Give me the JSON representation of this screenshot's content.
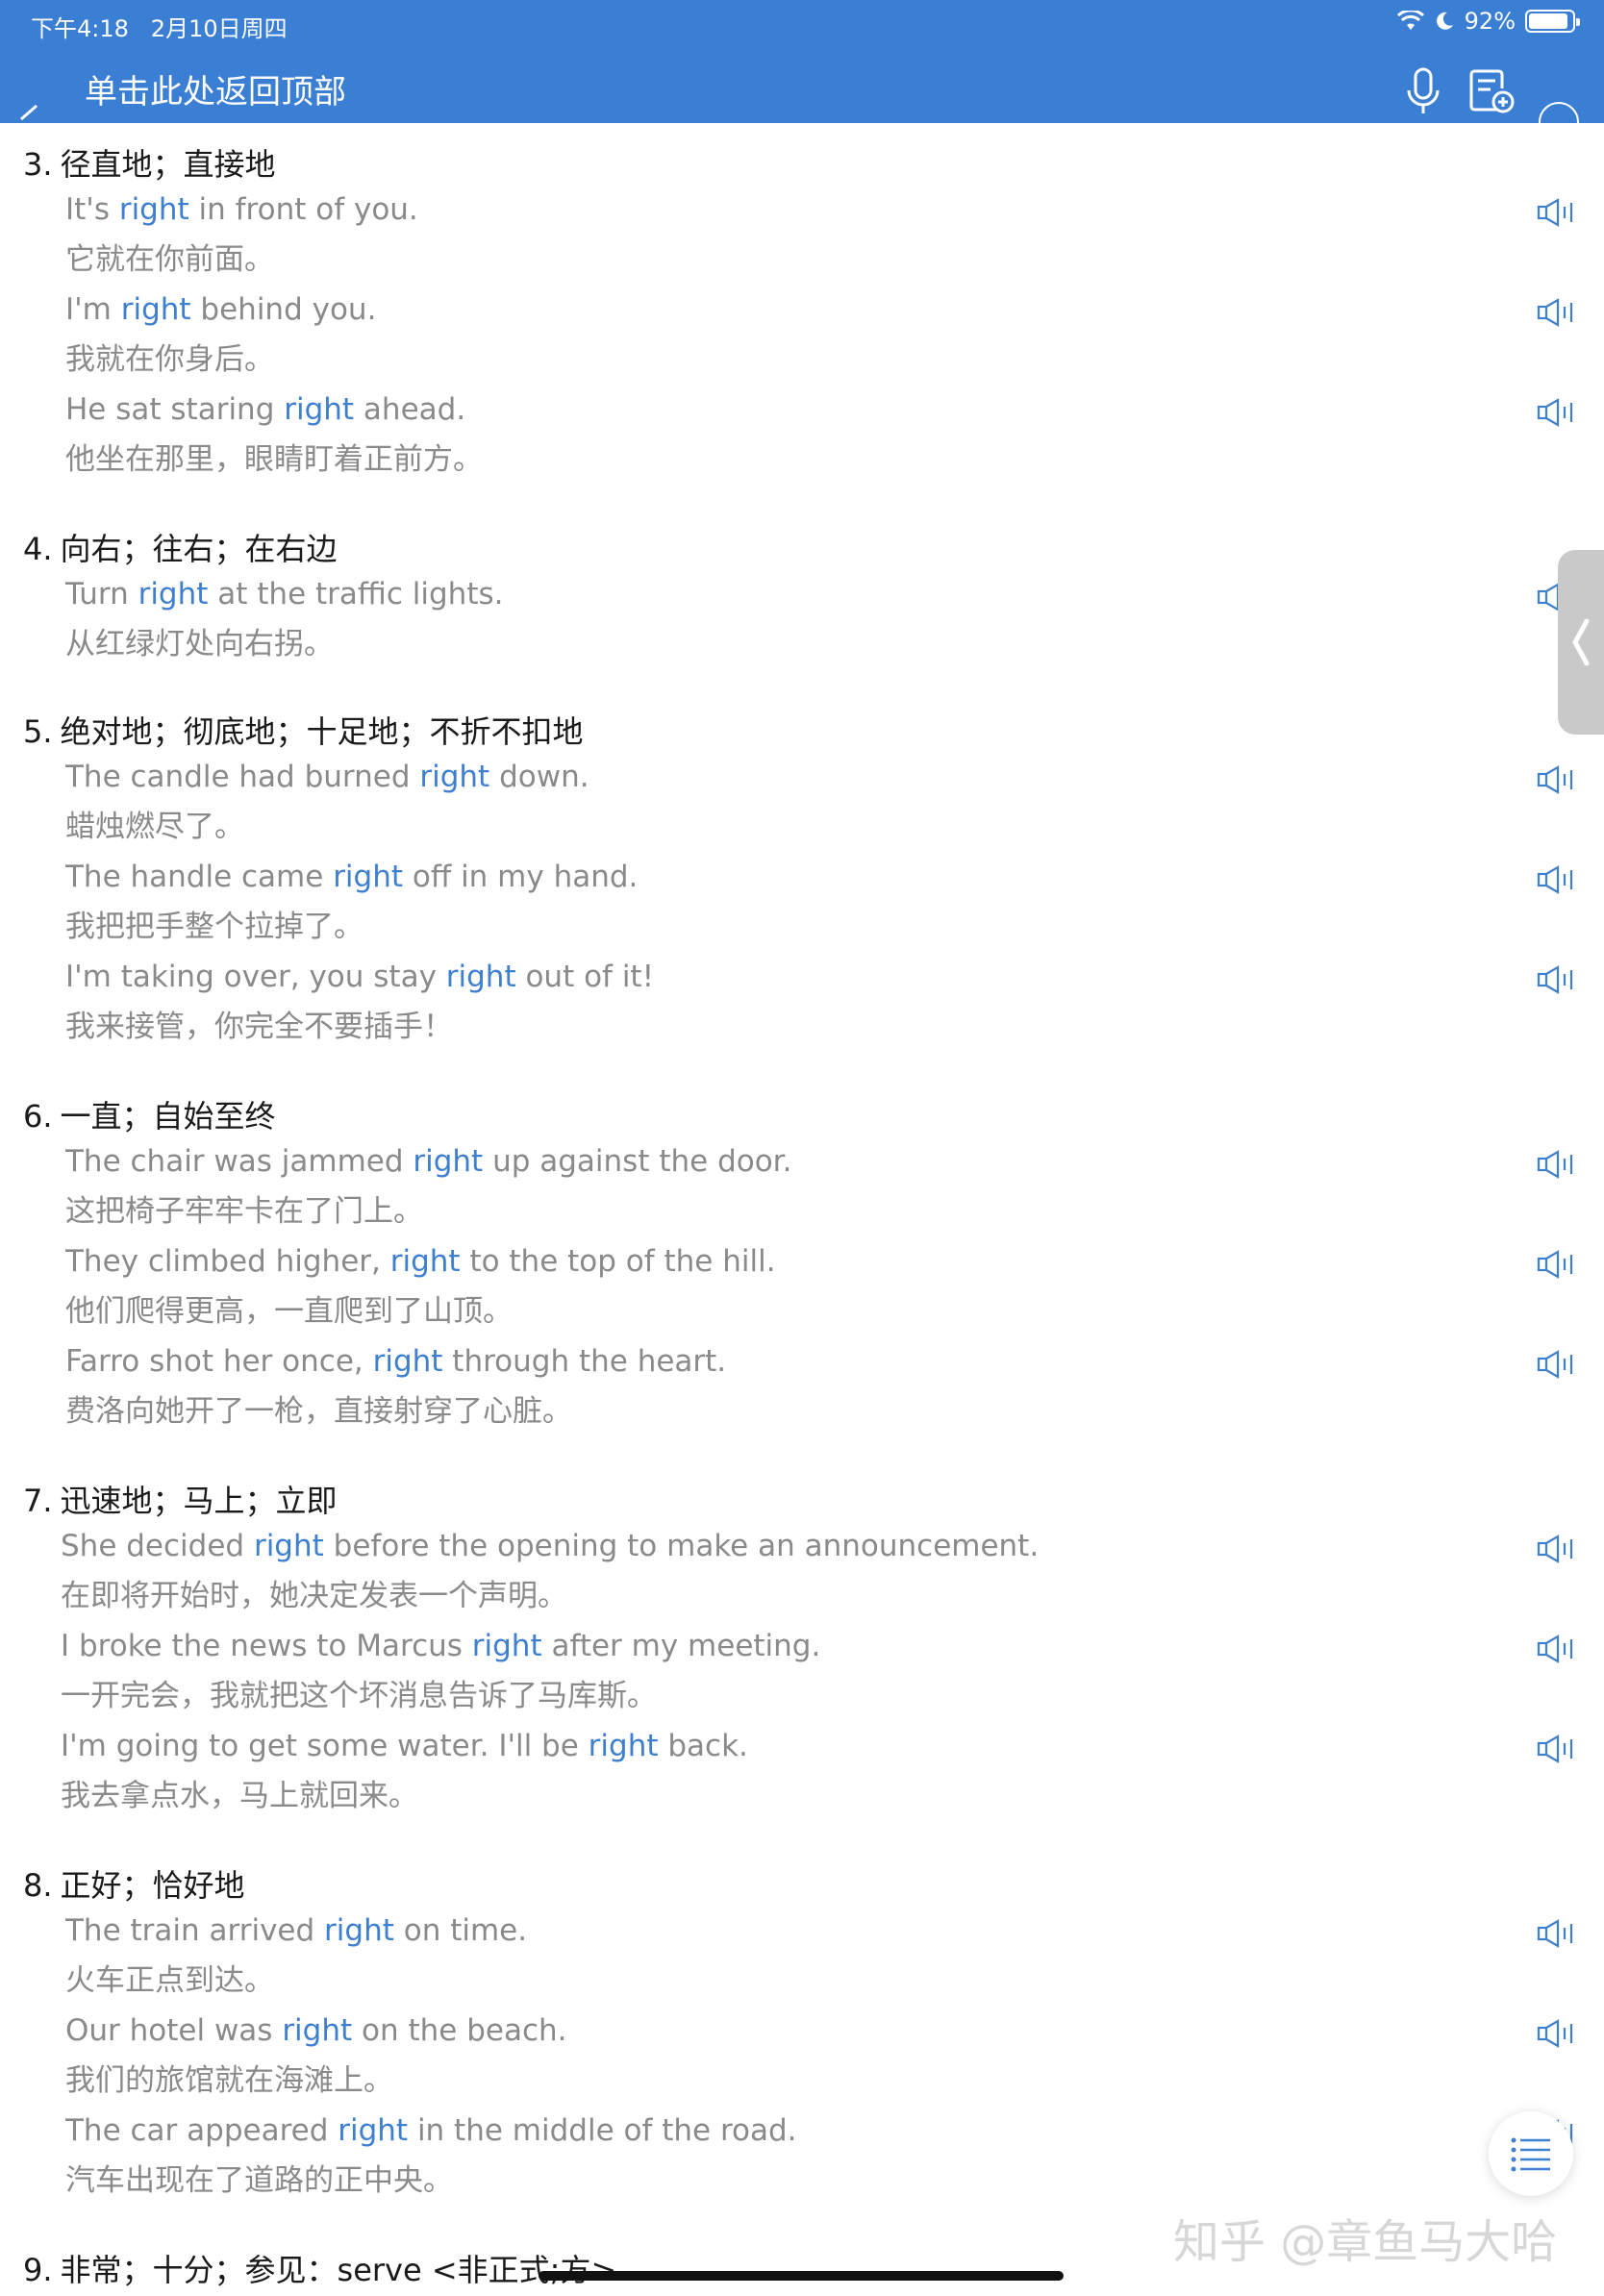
{
  "status_bar": {
    "time": "下午4:18",
    "date": "2月10日周四",
    "battery": "92%",
    "battery_level": 0.92
  },
  "header": {
    "title": "单击此处返回顶部",
    "icons": [
      "microphone-icon",
      "add-note-icon"
    ]
  },
  "colors": {
    "header": "#3b7fd4",
    "keyword": "#3f7fd0",
    "example_text": "#8a8a8a"
  },
  "senses": [
    {
      "number": "3.",
      "meaning": "径直地；直接地",
      "examples": [
        {
          "pre": "It's ",
          "kw": "right",
          "post": " in front of you.",
          "zh": "它就在你前面。"
        },
        {
          "pre": "I'm ",
          "kw": "right",
          "post": " behind you.",
          "zh": "我就在你身后。"
        },
        {
          "pre": "He sat staring ",
          "kw": "right",
          "post": " ahead.",
          "zh": "他坐在那里，眼睛盯着正前方。"
        }
      ]
    },
    {
      "number": "4.",
      "meaning": "向右；往右；在右边",
      "examples": [
        {
          "pre": "Turn ",
          "kw": "right",
          "post": " at the traffic lights.",
          "zh": "从红绿灯处向右拐。"
        }
      ]
    },
    {
      "number": "5.",
      "meaning": "绝对地；彻底地；十足地；不折不扣地",
      "examples": [
        {
          "pre": "The candle had burned ",
          "kw": "right",
          "post": " down.",
          "zh": "蜡烛燃尽了。"
        },
        {
          "pre": "The handle came ",
          "kw": "right",
          "post": " off in my hand.",
          "zh": "我把把手整个拉掉了。"
        },
        {
          "pre": "I'm taking over, you stay ",
          "kw": "right",
          "post": " out of it!",
          "zh": "我来接管，你完全不要插手！"
        }
      ]
    },
    {
      "number": "6.",
      "meaning": "一直；自始至终",
      "examples": [
        {
          "pre": "The chair was jammed ",
          "kw": "right",
          "post": " up against the door.",
          "zh": "这把椅子牢牢卡在了门上。"
        },
        {
          "pre": "They climbed higher, ",
          "kw": "right",
          "post": " to the top of the hill.",
          "zh": "他们爬得更高，一直爬到了山顶。"
        },
        {
          "pre": "Farro shot her once, ",
          "kw": "right",
          "post": " through the heart.",
          "zh": "费洛向她开了一枪，直接射穿了心脏。"
        }
      ]
    },
    {
      "number": "7.",
      "meaning": "迅速地；马上；立即",
      "examples": [
        {
          "pre": "She decided ",
          "kw": "right",
          "post": " before the opening to make an announcement.",
          "zh": "在即将开始时，她决定发表一个声明。"
        },
        {
          "pre": "I broke the news to Marcus ",
          "kw": "right",
          "post": " after my meeting.",
          "zh": "一开完会，我就把这个坏消息告诉了马库斯。"
        },
        {
          "pre": "I'm going to get some water. I'll be ",
          "kw": "right",
          "post": " back.",
          "zh": "我去拿点水，马上就回来。"
        }
      ]
    },
    {
      "number": "8.",
      "meaning": "正好；恰好地",
      "examples": [
        {
          "pre": "The train arrived ",
          "kw": "right",
          "post": " on time.",
          "zh": "火车正点到达。"
        },
        {
          "pre": "Our hotel was ",
          "kw": "right",
          "post": " on the beach.",
          "zh": "我们的旅馆就在海滩上。"
        },
        {
          "pre": "The car appeared ",
          "kw": "right",
          "post": " in the middle of the road.",
          "zh": "汽车出现在了道路的正中央。"
        }
      ]
    },
    {
      "number": "9.",
      "meaning": "非常；十分；参见：serve <非正式;方>",
      "examples": []
    }
  ],
  "watermark": "知乎 @章鱼马大哈"
}
